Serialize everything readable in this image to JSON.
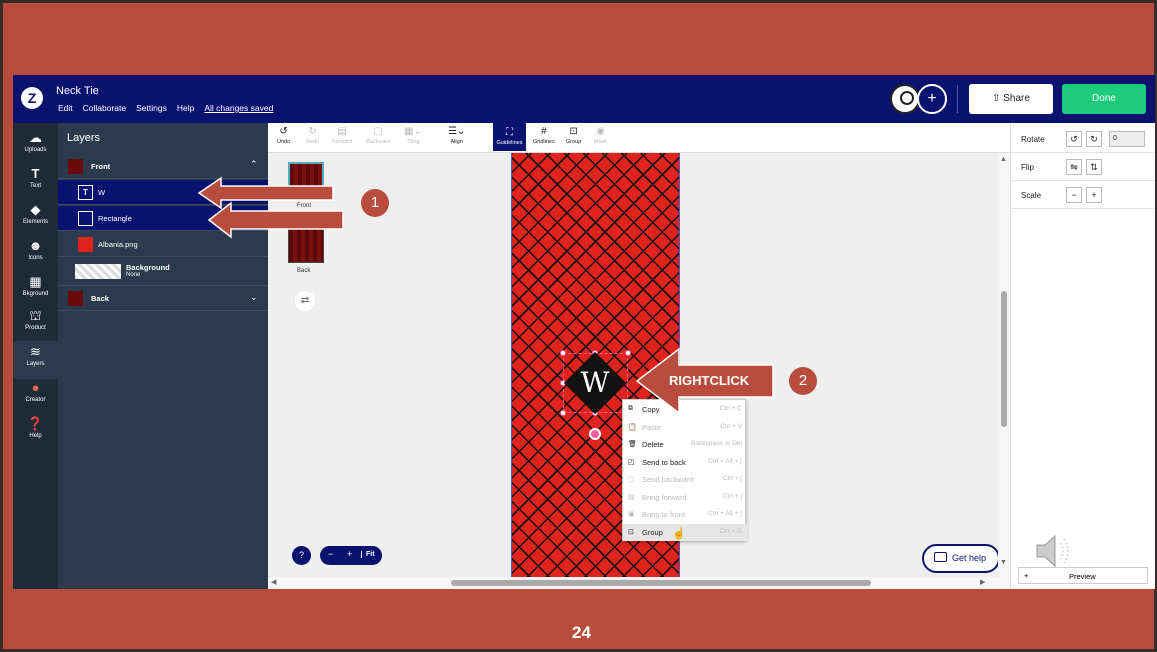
{
  "app": {
    "doc_title": "Neck Tie",
    "menu": [
      "Edit",
      "Collaborate",
      "Settings",
      "Help"
    ],
    "saved_status": "All changes saved",
    "share_label": "Share",
    "done_label": "Done",
    "logo_letter": "Z"
  },
  "rail": {
    "items": [
      {
        "label": "Uploads",
        "icon": "upload-cloud-icon"
      },
      {
        "label": "Text",
        "icon": "text-icon"
      },
      {
        "label": "Elements",
        "icon": "elements-icon"
      },
      {
        "label": "Icons",
        "icon": "smiley-icon"
      },
      {
        "label": "Bkground",
        "icon": "background-icon"
      },
      {
        "label": "Product",
        "icon": "product-icon"
      },
      {
        "label": "Layers",
        "icon": "layers-icon"
      },
      {
        "label": "Creator",
        "icon": "creator-avatar-icon"
      },
      {
        "label": "Help",
        "icon": "help-icon"
      }
    ]
  },
  "layers": {
    "title": "Layers",
    "front": "Front",
    "items": [
      "W",
      "Rectangle",
      "Albania.png"
    ],
    "background_label": "Background",
    "background_value": "None",
    "back": "Back"
  },
  "toolbar": {
    "items": [
      "Undo",
      "Redo",
      "Forward",
      "Backward",
      "Tiling",
      "Align",
      "Guidelines",
      "Gridlines",
      "Group",
      "Mask"
    ]
  },
  "pages": {
    "front": "Front",
    "back": "Back"
  },
  "canvas": {
    "letter": "W"
  },
  "context_menu": {
    "items": [
      {
        "label": "Copy",
        "shortcut": "Ctrl + C",
        "enabled": true
      },
      {
        "label": "Paste",
        "shortcut": "Ctrl + V",
        "enabled": false
      },
      {
        "label": "Delete",
        "shortcut": "Backspace or Del",
        "enabled": true
      },
      {
        "label": "Send to back",
        "shortcut": "Ctrl + Alt + [",
        "enabled": true
      },
      {
        "label": "Send backward",
        "shortcut": "Ctrl + [",
        "enabled": false
      },
      {
        "label": "Bring forward",
        "shortcut": "Ctrl + ]",
        "enabled": false
      },
      {
        "label": "Bring to front",
        "shortcut": "Ctrl + Alt + ]",
        "enabled": false
      },
      {
        "label": "Group",
        "shortcut": "Ctrl + G",
        "enabled": false
      }
    ]
  },
  "zoom": {
    "help": "?",
    "minus": "−",
    "plus": "+",
    "fit": "Fit"
  },
  "get_help": "Get help",
  "right_panel": {
    "rotate": "Rotate",
    "rotate_value": "0",
    "flip": "Flip",
    "scale": "Scale",
    "preview_plus": "+",
    "preview": "Preview"
  },
  "annotations": {
    "badge1": "1",
    "badge2": "2",
    "rightclick": "RIGHTCLICK"
  },
  "slide_number": "24",
  "colors": {
    "slide_bg": "#b94d3d",
    "navy": "#0a1270",
    "done_green": "#1dcc7a",
    "selection_pink": "#ff5fa2"
  }
}
